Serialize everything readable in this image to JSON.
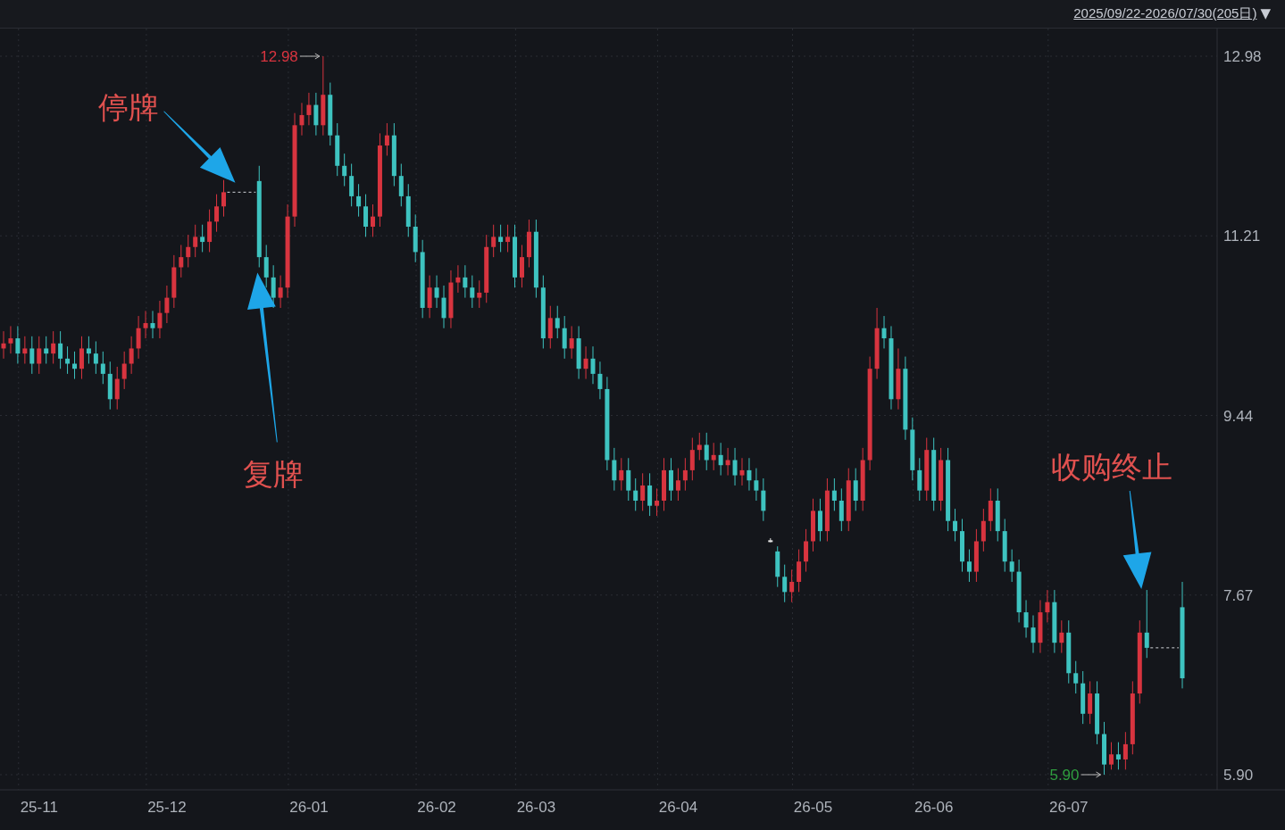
{
  "header": {
    "date_range": "2025/09/22-2026/07/30(205日)",
    "dropdown_glyph": "▼"
  },
  "chart": {
    "chart_data": {
      "type": "candlestick",
      "grid": true,
      "ylim": [
        5.9,
        12.98
      ],
      "yticks": [
        {
          "value": 12.98,
          "label": "12.98"
        },
        {
          "value": 11.21,
          "label": "11.21"
        },
        {
          "value": 9.44,
          "label": "9.44"
        },
        {
          "value": 7.67,
          "label": "7.67"
        },
        {
          "value": 5.9,
          "label": "5.90"
        }
      ],
      "categories": [
        null,
        null,
        null,
        null,
        null,
        "25-11",
        null,
        null,
        null,
        null,
        null,
        null,
        null,
        null,
        null,
        null,
        null,
        null,
        null,
        null,
        null,
        null,
        null,
        "25-12",
        null,
        null,
        null,
        null,
        null,
        null,
        null,
        null,
        null,
        null,
        null,
        null,
        null,
        null,
        null,
        null,
        null,
        null,
        null,
        "26-01",
        null,
        null,
        null,
        null,
        null,
        null,
        null,
        null,
        null,
        null,
        null,
        null,
        null,
        null,
        null,
        null,
        null,
        "26-02",
        null,
        null,
        null,
        null,
        null,
        null,
        null,
        null,
        null,
        null,
        null,
        null,
        null,
        "26-03",
        null,
        null,
        null,
        null,
        null,
        null,
        null,
        null,
        null,
        null,
        null,
        null,
        null,
        null,
        null,
        null,
        null,
        null,
        null,
        "26-04",
        null,
        null,
        null,
        null,
        null,
        null,
        null,
        null,
        null,
        null,
        null,
        null,
        null,
        null,
        null,
        null,
        null,
        null,
        "26-05",
        null,
        null,
        null,
        null,
        null,
        null,
        null,
        null,
        null,
        null,
        null,
        null,
        null,
        null,
        null,
        null,
        "26-06",
        null,
        null,
        null,
        null,
        null,
        null,
        null,
        null,
        null,
        null,
        null,
        null,
        null,
        null,
        null,
        null,
        null,
        null,
        "26-07",
        null,
        null,
        null,
        null,
        null,
        null,
        null,
        null,
        null,
        null,
        null,
        null,
        null,
        null,
        null,
        null
      ],
      "ohlc": [
        [
          10.1,
          10.27,
          10.0,
          10.15
        ],
        [
          10.15,
          10.32,
          10.05,
          10.2
        ],
        [
          10.2,
          10.32,
          9.95,
          10.05
        ],
        [
          10.05,
          10.22,
          9.95,
          10.1
        ],
        [
          10.1,
          10.22,
          9.85,
          9.95
        ],
        [
          9.95,
          10.22,
          9.85,
          10.1
        ],
        [
          10.1,
          10.22,
          9.95,
          10.05
        ],
        [
          10.05,
          10.27,
          9.95,
          10.15
        ],
        [
          10.15,
          10.27,
          9.9,
          10.0
        ],
        [
          10.0,
          10.12,
          9.85,
          9.95
        ],
        [
          9.95,
          10.07,
          9.8,
          9.9
        ],
        [
          9.9,
          10.22,
          9.8,
          10.1
        ],
        [
          10.1,
          10.22,
          9.95,
          10.05
        ],
        [
          10.05,
          10.17,
          9.85,
          9.95
        ],
        [
          9.95,
          10.07,
          9.75,
          9.85
        ],
        [
          9.85,
          9.97,
          9.5,
          9.6
        ],
        [
          9.6,
          9.92,
          9.5,
          9.8
        ],
        [
          9.8,
          10.07,
          9.7,
          9.95
        ],
        [
          9.95,
          10.22,
          9.85,
          10.1
        ],
        [
          10.1,
          10.42,
          10.0,
          10.3
        ],
        [
          10.3,
          10.47,
          10.2,
          10.35
        ],
        [
          10.35,
          10.47,
          10.2,
          10.3
        ],
        [
          10.3,
          10.57,
          10.2,
          10.45
        ],
        [
          10.45,
          10.72,
          10.35,
          10.6
        ],
        [
          10.6,
          11.02,
          10.5,
          10.9
        ],
        [
          10.9,
          11.12,
          10.8,
          11.0
        ],
        [
          11.0,
          11.22,
          10.9,
          11.1
        ],
        [
          11.1,
          11.32,
          11.0,
          11.2
        ],
        [
          11.2,
          11.32,
          11.05,
          11.15
        ],
        [
          11.15,
          11.47,
          11.05,
          11.35
        ],
        [
          11.35,
          11.62,
          11.25,
          11.5
        ],
        [
          11.5,
          11.76,
          11.4,
          11.64
        ],
        null,
        null,
        null,
        null,
        [
          11.75,
          11.9,
          10.9,
          11.0
        ],
        [
          11.0,
          11.12,
          10.7,
          10.8
        ],
        [
          10.8,
          10.92,
          10.5,
          10.6
        ],
        [
          10.6,
          10.82,
          10.5,
          10.7
        ],
        [
          10.7,
          11.52,
          10.6,
          11.4
        ],
        [
          11.4,
          12.42,
          11.3,
          12.3
        ],
        [
          12.3,
          12.52,
          12.2,
          12.4
        ],
        [
          12.4,
          12.62,
          12.3,
          12.5
        ],
        [
          12.5,
          12.62,
          12.2,
          12.3
        ],
        [
          12.3,
          12.98,
          12.2,
          12.6
        ],
        [
          12.6,
          12.72,
          12.1,
          12.2
        ],
        [
          12.2,
          12.32,
          11.8,
          11.9
        ],
        [
          11.9,
          12.02,
          11.7,
          11.8
        ],
        [
          11.8,
          11.92,
          11.5,
          11.6
        ],
        [
          11.6,
          11.72,
          11.4,
          11.5
        ],
        [
          11.5,
          11.62,
          11.2,
          11.3
        ],
        [
          11.3,
          11.52,
          11.2,
          11.4
        ],
        [
          11.4,
          12.22,
          11.3,
          12.1
        ],
        [
          12.1,
          12.32,
          12.0,
          12.2
        ],
        [
          12.2,
          12.32,
          11.7,
          11.8
        ],
        [
          11.8,
          11.92,
          11.5,
          11.6
        ],
        [
          11.6,
          11.72,
          11.2,
          11.3
        ],
        [
          11.3,
          11.42,
          10.95,
          11.05
        ],
        [
          11.05,
          11.17,
          10.4,
          10.5
        ],
        [
          10.5,
          10.82,
          10.4,
          10.7
        ],
        [
          10.7,
          10.82,
          10.5,
          10.6
        ],
        [
          10.6,
          10.72,
          10.3,
          10.4
        ],
        [
          10.4,
          10.87,
          10.3,
          10.75
        ],
        [
          10.75,
          10.92,
          10.65,
          10.8
        ],
        [
          10.8,
          10.92,
          10.6,
          10.7
        ],
        [
          10.7,
          10.82,
          10.5,
          10.6
        ],
        [
          10.6,
          10.77,
          10.5,
          10.65
        ],
        [
          10.65,
          11.22,
          10.55,
          11.1
        ],
        [
          11.1,
          11.32,
          11.0,
          11.2
        ],
        [
          11.2,
          11.32,
          11.05,
          11.15
        ],
        [
          11.15,
          11.32,
          11.05,
          11.2
        ],
        [
          11.2,
          11.32,
          10.7,
          10.8
        ],
        [
          10.8,
          11.12,
          10.7,
          11.0
        ],
        [
          11.0,
          11.37,
          10.9,
          11.25
        ],
        [
          11.25,
          11.37,
          10.6,
          10.7
        ],
        [
          10.7,
          10.82,
          10.1,
          10.2
        ],
        [
          10.2,
          10.52,
          10.1,
          10.4
        ],
        [
          10.4,
          10.52,
          10.2,
          10.3
        ],
        [
          10.3,
          10.42,
          10.0,
          10.1
        ],
        [
          10.1,
          10.32,
          10.0,
          10.2
        ],
        [
          10.2,
          10.32,
          9.8,
          9.9
        ],
        [
          9.9,
          10.12,
          9.8,
          10.0
        ],
        [
          10.0,
          10.12,
          9.75,
          9.85
        ],
        [
          9.85,
          9.97,
          9.6,
          9.7
        ],
        [
          9.7,
          9.82,
          8.9,
          9.0
        ],
        [
          9.0,
          9.12,
          8.7,
          8.8
        ],
        [
          8.8,
          9.02,
          8.7,
          8.9
        ],
        [
          8.9,
          9.02,
          8.6,
          8.7
        ],
        [
          8.7,
          8.82,
          8.5,
          8.6
        ],
        [
          8.6,
          8.87,
          8.5,
          8.75
        ],
        [
          8.75,
          8.87,
          8.45,
          8.55
        ],
        [
          8.55,
          8.72,
          8.45,
          8.6
        ],
        [
          8.6,
          9.02,
          8.5,
          8.9
        ],
        [
          8.9,
          9.02,
          8.6,
          8.7
        ],
        [
          8.7,
          8.92,
          8.6,
          8.8
        ],
        [
          8.8,
          9.02,
          8.7,
          8.9
        ],
        [
          8.9,
          9.22,
          8.8,
          9.1
        ],
        [
          9.1,
          9.27,
          9.0,
          9.15
        ],
        [
          9.15,
          9.27,
          8.9,
          9.0
        ],
        [
          9.0,
          9.17,
          8.9,
          9.05
        ],
        [
          9.05,
          9.17,
          8.85,
          8.95
        ],
        [
          8.95,
          9.12,
          8.85,
          9.0
        ],
        [
          9.0,
          9.12,
          8.75,
          8.85
        ],
        [
          8.85,
          9.02,
          8.75,
          8.9
        ],
        [
          8.9,
          9.02,
          8.7,
          8.8
        ],
        [
          8.8,
          8.92,
          8.6,
          8.7
        ],
        [
          8.7,
          8.82,
          8.4,
          8.5
        ],
        [
          8.21,
          8.23,
          8.19,
          8.21
        ],
        [
          8.1,
          8.15,
          7.75,
          7.85
        ],
        [
          7.85,
          7.97,
          7.6,
          7.7
        ],
        [
          7.7,
          7.92,
          7.6,
          7.8
        ],
        [
          7.8,
          8.12,
          7.7,
          8.0
        ],
        [
          8.0,
          8.32,
          7.9,
          8.2
        ],
        [
          8.2,
          8.62,
          8.1,
          8.5
        ],
        [
          8.5,
          8.62,
          8.2,
          8.3
        ],
        [
          8.3,
          8.82,
          8.2,
          8.7
        ],
        [
          8.7,
          8.82,
          8.5,
          8.6
        ],
        [
          8.6,
          8.72,
          8.3,
          8.4
        ],
        [
          8.4,
          8.92,
          8.3,
          8.8
        ],
        [
          8.8,
          8.92,
          8.5,
          8.6
        ],
        [
          8.6,
          9.12,
          8.5,
          9.0
        ],
        [
          9.0,
          10.02,
          8.9,
          9.9
        ],
        [
          9.9,
          10.5,
          9.8,
          10.3
        ],
        [
          10.3,
          10.42,
          10.1,
          10.2
        ],
        [
          10.2,
          10.32,
          9.5,
          9.6
        ],
        [
          9.6,
          10.1,
          9.5,
          9.9
        ],
        [
          9.9,
          10.02,
          9.2,
          9.3
        ],
        [
          9.3,
          9.42,
          8.8,
          8.9
        ],
        [
          8.9,
          9.02,
          8.6,
          8.7
        ],
        [
          8.7,
          9.22,
          8.6,
          9.1
        ],
        [
          9.1,
          9.22,
          8.5,
          8.6
        ],
        [
          8.6,
          9.12,
          8.5,
          9.0
        ],
        [
          9.0,
          9.12,
          8.3,
          8.4
        ],
        [
          8.4,
          8.52,
          8.2,
          8.3
        ],
        [
          8.3,
          8.42,
          7.9,
          8.0
        ],
        [
          8.0,
          8.12,
          7.8,
          7.9
        ],
        [
          7.9,
          8.32,
          7.8,
          8.2
        ],
        [
          8.2,
          8.52,
          8.1,
          8.4
        ],
        [
          8.4,
          8.72,
          8.3,
          8.6
        ],
        [
          8.6,
          8.72,
          8.2,
          8.3
        ],
        [
          8.3,
          8.42,
          7.9,
          8.0
        ],
        [
          8.0,
          8.12,
          7.8,
          7.9
        ],
        [
          7.9,
          8.02,
          7.4,
          7.5
        ],
        [
          7.5,
          7.62,
          7.25,
          7.35
        ],
        [
          7.35,
          7.47,
          7.1,
          7.2
        ],
        [
          7.2,
          7.62,
          7.1,
          7.5
        ],
        [
          7.5,
          7.72,
          7.4,
          7.6
        ],
        [
          7.6,
          7.72,
          7.1,
          7.2
        ],
        [
          7.2,
          7.42,
          7.1,
          7.3
        ],
        [
          7.3,
          7.42,
          6.8,
          6.9
        ],
        [
          6.9,
          7.02,
          6.7,
          6.8
        ],
        [
          6.8,
          6.92,
          6.4,
          6.5
        ],
        [
          6.5,
          6.82,
          6.4,
          6.7
        ],
        [
          6.7,
          6.82,
          6.2,
          6.3
        ],
        [
          6.3,
          6.42,
          5.9,
          6.0
        ],
        [
          6.0,
          6.22,
          5.95,
          6.1
        ],
        [
          6.1,
          6.22,
          5.95,
          6.05
        ],
        [
          6.05,
          6.32,
          5.95,
          6.2
        ],
        [
          6.2,
          6.82,
          6.1,
          6.7
        ],
        [
          6.7,
          7.42,
          6.6,
          7.3
        ],
        [
          7.3,
          7.72,
          7.05,
          7.15
        ],
        null,
        null,
        null,
        null,
        [
          7.55,
          7.8,
          6.75,
          6.85
        ]
      ],
      "annotations": [
        "12.98",
        "5.90",
        "停牌",
        "复牌",
        "收购终止"
      ]
    }
  }
}
